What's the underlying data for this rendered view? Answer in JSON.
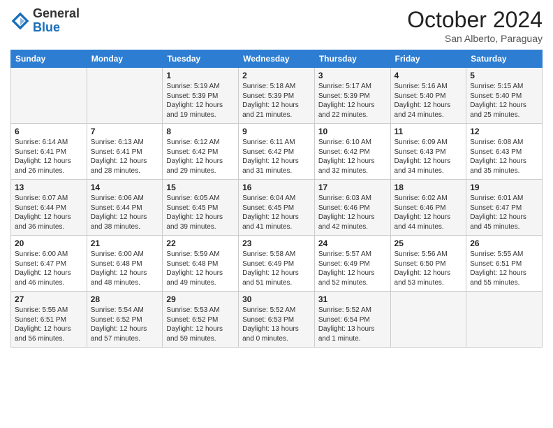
{
  "header": {
    "logo": {
      "general": "General",
      "blue": "Blue"
    },
    "month": "October 2024",
    "location": "San Alberto, Paraguay"
  },
  "weekdays": [
    "Sunday",
    "Monday",
    "Tuesday",
    "Wednesday",
    "Thursday",
    "Friday",
    "Saturday"
  ],
  "weeks": [
    [
      null,
      null,
      {
        "day": "1",
        "sunrise": "5:19 AM",
        "sunset": "5:39 PM",
        "daylight": "12 hours and 19 minutes."
      },
      {
        "day": "2",
        "sunrise": "5:18 AM",
        "sunset": "5:39 PM",
        "daylight": "12 hours and 21 minutes."
      },
      {
        "day": "3",
        "sunrise": "5:17 AM",
        "sunset": "5:39 PM",
        "daylight": "12 hours and 22 minutes."
      },
      {
        "day": "4",
        "sunrise": "5:16 AM",
        "sunset": "5:40 PM",
        "daylight": "12 hours and 24 minutes."
      },
      {
        "day": "5",
        "sunrise": "5:15 AM",
        "sunset": "5:40 PM",
        "daylight": "12 hours and 25 minutes."
      }
    ],
    [
      {
        "day": "6",
        "sunrise": "6:14 AM",
        "sunset": "6:41 PM",
        "daylight": "12 hours and 26 minutes."
      },
      {
        "day": "7",
        "sunrise": "6:13 AM",
        "sunset": "6:41 PM",
        "daylight": "12 hours and 28 minutes."
      },
      {
        "day": "8",
        "sunrise": "6:12 AM",
        "sunset": "6:42 PM",
        "daylight": "12 hours and 29 minutes."
      },
      {
        "day": "9",
        "sunrise": "6:11 AM",
        "sunset": "6:42 PM",
        "daylight": "12 hours and 31 minutes."
      },
      {
        "day": "10",
        "sunrise": "6:10 AM",
        "sunset": "6:42 PM",
        "daylight": "12 hours and 32 minutes."
      },
      {
        "day": "11",
        "sunrise": "6:09 AM",
        "sunset": "6:43 PM",
        "daylight": "12 hours and 34 minutes."
      },
      {
        "day": "12",
        "sunrise": "6:08 AM",
        "sunset": "6:43 PM",
        "daylight": "12 hours and 35 minutes."
      }
    ],
    [
      {
        "day": "13",
        "sunrise": "6:07 AM",
        "sunset": "6:44 PM",
        "daylight": "12 hours and 36 minutes."
      },
      {
        "day": "14",
        "sunrise": "6:06 AM",
        "sunset": "6:44 PM",
        "daylight": "12 hours and 38 minutes."
      },
      {
        "day": "15",
        "sunrise": "6:05 AM",
        "sunset": "6:45 PM",
        "daylight": "12 hours and 39 minutes."
      },
      {
        "day": "16",
        "sunrise": "6:04 AM",
        "sunset": "6:45 PM",
        "daylight": "12 hours and 41 minutes."
      },
      {
        "day": "17",
        "sunrise": "6:03 AM",
        "sunset": "6:46 PM",
        "daylight": "12 hours and 42 minutes."
      },
      {
        "day": "18",
        "sunrise": "6:02 AM",
        "sunset": "6:46 PM",
        "daylight": "12 hours and 44 minutes."
      },
      {
        "day": "19",
        "sunrise": "6:01 AM",
        "sunset": "6:47 PM",
        "daylight": "12 hours and 45 minutes."
      }
    ],
    [
      {
        "day": "20",
        "sunrise": "6:00 AM",
        "sunset": "6:47 PM",
        "daylight": "12 hours and 46 minutes."
      },
      {
        "day": "21",
        "sunrise": "6:00 AM",
        "sunset": "6:48 PM",
        "daylight": "12 hours and 48 minutes."
      },
      {
        "day": "22",
        "sunrise": "5:59 AM",
        "sunset": "6:48 PM",
        "daylight": "12 hours and 49 minutes."
      },
      {
        "day": "23",
        "sunrise": "5:58 AM",
        "sunset": "6:49 PM",
        "daylight": "12 hours and 51 minutes."
      },
      {
        "day": "24",
        "sunrise": "5:57 AM",
        "sunset": "6:49 PM",
        "daylight": "12 hours and 52 minutes."
      },
      {
        "day": "25",
        "sunrise": "5:56 AM",
        "sunset": "6:50 PM",
        "daylight": "12 hours and 53 minutes."
      },
      {
        "day": "26",
        "sunrise": "5:55 AM",
        "sunset": "6:51 PM",
        "daylight": "12 hours and 55 minutes."
      }
    ],
    [
      {
        "day": "27",
        "sunrise": "5:55 AM",
        "sunset": "6:51 PM",
        "daylight": "12 hours and 56 minutes."
      },
      {
        "day": "28",
        "sunrise": "5:54 AM",
        "sunset": "6:52 PM",
        "daylight": "12 hours and 57 minutes."
      },
      {
        "day": "29",
        "sunrise": "5:53 AM",
        "sunset": "6:52 PM",
        "daylight": "12 hours and 59 minutes."
      },
      {
        "day": "30",
        "sunrise": "5:52 AM",
        "sunset": "6:53 PM",
        "daylight": "13 hours and 0 minutes."
      },
      {
        "day": "31",
        "sunrise": "5:52 AM",
        "sunset": "6:54 PM",
        "daylight": "13 hours and 1 minute."
      },
      null,
      null
    ]
  ],
  "labels": {
    "sunrise_prefix": "Sunrise: ",
    "sunset_prefix": "Sunset: ",
    "daylight_prefix": "Daylight: "
  }
}
